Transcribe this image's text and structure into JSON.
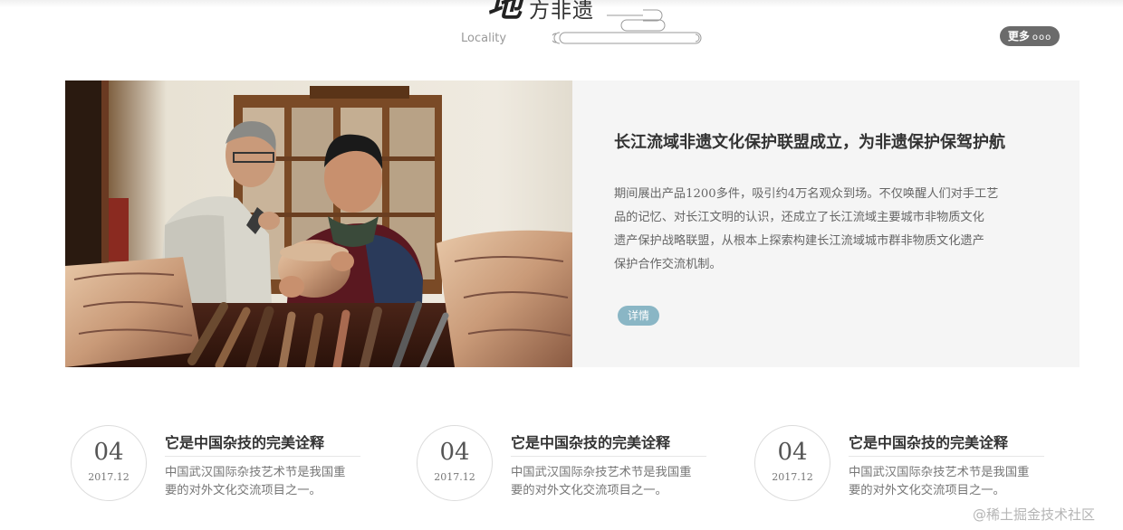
{
  "section": {
    "title_big": "地",
    "title_rest": "方非遗",
    "title_en": "Locality",
    "more_label": "更多",
    "more_dots": "ooo"
  },
  "feature": {
    "image": "artisans-carving-photo",
    "title": "长江流域非遗文化保护联盟成立，为非遗保护保驾护航",
    "desc_lines": [
      "期间展出产品1200多件，吸引约4万名观众到场。不仅唤醒人们对手工艺",
      "品的记忆、对长江文明的认识，还成立了长江流域主要城市非物质文化",
      "遗产保护战略联盟，从根本上探索构建长江流域城市群非物质文化遗产",
      "保护合作交流机制。"
    ],
    "detail_label": "详情",
    "detail_color": "#8ab6c5"
  },
  "news": [
    {
      "day": "04",
      "date": "2017.12",
      "title": "它是中国杂技的完美诠释",
      "desc_lines": [
        "中国武汉国际杂技艺术节是我国重",
        "要的对外文化交流项目之一。"
      ]
    },
    {
      "day": "04",
      "date": "2017.12",
      "title": "它是中国杂技的完美诠释",
      "desc_lines": [
        "中国武汉国际杂技艺术节是我国重",
        "要的对外文化交流项目之一。"
      ]
    },
    {
      "day": "04",
      "date": "2017.12",
      "title": "它是中国杂技的完美诠释",
      "desc_lines": [
        "中国武汉国际杂技艺术节是我国重",
        "要的对外文化交流项目之一。"
      ]
    }
  ],
  "watermark": "@稀土掘金技术社区",
  "colors": {
    "more_bg": "#6b6b6b",
    "feature_bg": "#f5f5f5"
  }
}
